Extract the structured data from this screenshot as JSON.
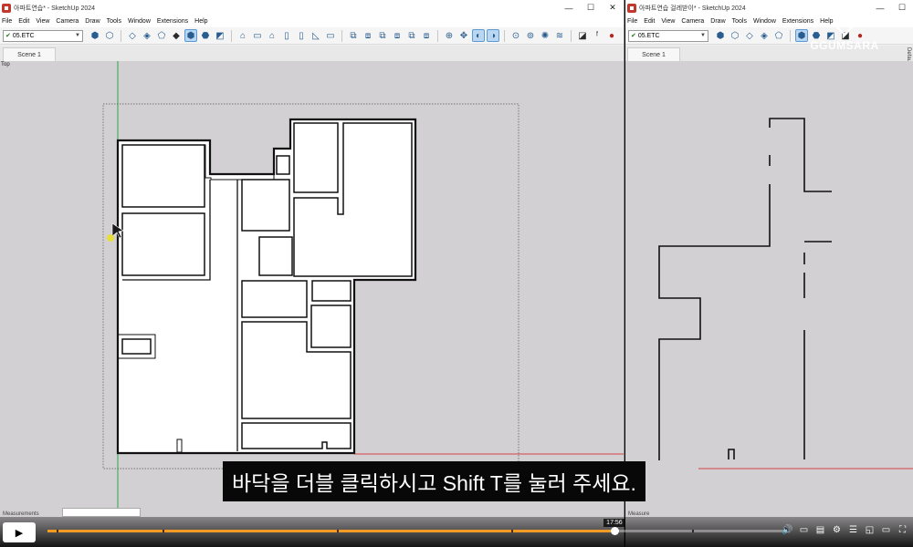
{
  "left_window": {
    "title": "아파트연습* - SketchUp 2024",
    "menus": [
      "File",
      "Edit",
      "View",
      "Camera",
      "Draw",
      "Tools",
      "Window",
      "Extensions",
      "Help"
    ],
    "tag": "05.ETC",
    "scene_tab": "Scene 1",
    "view_label": "Top",
    "measurements_label": "Measurements"
  },
  "right_window": {
    "title": "아파트연습 걸레받이* - SketchUp 2024",
    "menus": [
      "File",
      "Edit",
      "View",
      "Camera",
      "Draw",
      "Tools",
      "Window",
      "Extensions",
      "Help"
    ],
    "tag": "05.ETC",
    "scene_tab": "Scene 1",
    "tray_label": "Default Tray",
    "measurements_label": "Measure"
  },
  "watermark": "GGUMSARA",
  "subtitle": "바닥을 더블 클릭하시고 Shift T를 눌러 주세요.",
  "player": {
    "current_time": "17:56",
    "progress": 0.765,
    "chapters": [
      0.012,
      0.155,
      0.39,
      0.625,
      0.87
    ],
    "icons": [
      "play-icon",
      "volume-icon",
      "subtitles-icon",
      "settings-icon",
      "miniplayer-icon",
      "theater-icon",
      "fullscreen-icon"
    ]
  },
  "colors": {
    "viewport": "#d3d0d3",
    "progress_fill": "#f49b26",
    "axis_green": "#2ea44f",
    "axis_red": "#d64545"
  },
  "toolbar_icons": [
    "components-icon",
    "materials-icon",
    "xray-icon",
    "back-edges-icon",
    "wireframe-icon",
    "hidden-line-icon",
    "shaded-icon",
    "shaded-textures-icon",
    "monochrome-icon",
    "iso-view-icon",
    "top-view-icon",
    "front-view-icon",
    "right-view-icon",
    "back-view-icon",
    "left-view-icon",
    "outer-shell-icon",
    "intersect-icon",
    "union-icon",
    "subtract-icon",
    "trim-icon",
    "split-icon",
    "orbit-icon",
    "pan-icon",
    "zoom-icon",
    "zoom-extents-icon",
    "section-plane-icon",
    "display-section-icon",
    "sandbox-icon",
    "paint-icon",
    "tape-icon",
    "ruby-icon"
  ]
}
